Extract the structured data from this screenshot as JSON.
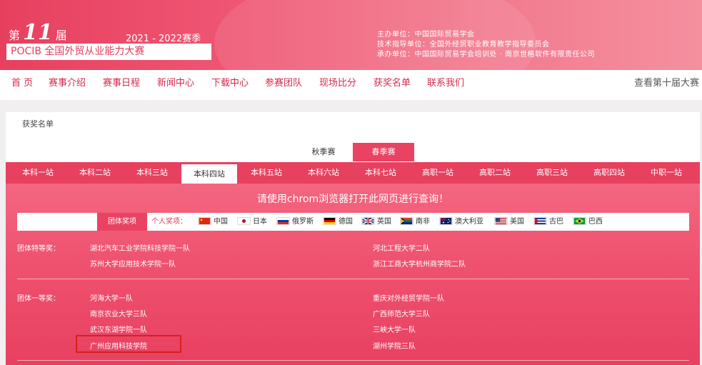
{
  "header": {
    "edition_prefix": "第",
    "edition_number": "11",
    "edition_suffix": "届",
    "season": "2021 - 2022赛季",
    "title": "POCIB 全国外贸从业能力大赛",
    "organizers": [
      "主办单位：中国国际贸易学会",
      "技术指导单位：全国外经贸职业教育教学指导委员会",
      "承办单位：中国国际贸易学会培训处 · 南京世格软件有限责任公司"
    ]
  },
  "nav": {
    "items": [
      "首 页",
      "赛事介绍",
      "赛事日程",
      "新闻中心",
      "下载中心",
      "参赛团队",
      "现场比分",
      "获奖名单",
      "联系我们"
    ],
    "right_link": "查看第十届大赛"
  },
  "breadcrumb": "获奖名单",
  "seasons": {
    "inactive": "秋季赛",
    "active": "春季赛"
  },
  "stations": [
    "本科一站",
    "本科二站",
    "本科三站",
    "本科四站",
    "本科五站",
    "本科六站",
    "本科七站",
    "高职一站",
    "高职二站",
    "高职三站",
    "高职四站",
    "中职一站"
  ],
  "active_station": "本科四站",
  "notice": "请使用chrom浏览器打开此网页进行查询！",
  "filter": {
    "team_label": "团体奖项",
    "personal_label": "个人奖项：",
    "countries": [
      "中国",
      "日本",
      "俄罗斯",
      "德国",
      "英国",
      "南非",
      "澳大利亚",
      "美国",
      "古巴",
      "巴西"
    ]
  },
  "awards": {
    "special": {
      "label": "团体特等奖：",
      "left": [
        "湖北汽车工业学院科技学院一队",
        "苏州大学应用技术学院一队"
      ],
      "right": [
        "河北工程大学二队",
        "浙江工商大学杭州商学院二队"
      ]
    },
    "first": {
      "label": "团体一等奖：",
      "left": [
        "河海大学一队",
        "南京农业大学三队",
        "武汉东湖学院一队",
        "广州应用科技学院"
      ],
      "right": [
        "重庆对外经贸学院一队",
        "广西师范大学三队",
        "三峡大学一队",
        "湖州学院三队"
      ]
    }
  },
  "colors": {
    "brand": "#e8405f",
    "highlight": "#d82020"
  }
}
